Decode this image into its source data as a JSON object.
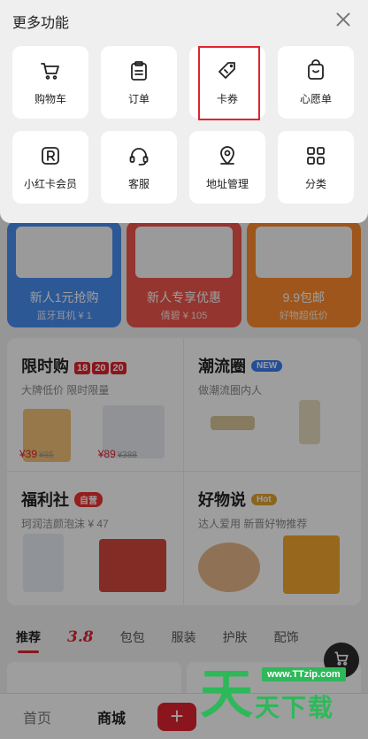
{
  "menu": {
    "title": "更多功能",
    "items": [
      {
        "label": "购物车",
        "icon": "shopping-cart-icon"
      },
      {
        "label": "订单",
        "icon": "clipboard-order-icon"
      },
      {
        "label": "卡券",
        "icon": "coupon-tag-icon"
      },
      {
        "label": "心愿单",
        "icon": "bag-smile-icon"
      },
      {
        "label": "小红卡会员",
        "icon": "r-badge-icon"
      },
      {
        "label": "客服",
        "icon": "headset-icon"
      },
      {
        "label": "地址管理",
        "icon": "location-pin-icon"
      },
      {
        "label": "分类",
        "icon": "category-grid-icon"
      }
    ],
    "highlighted_item": "卡券",
    "highlight_color": "#e0232f"
  },
  "promos": [
    {
      "title": "新人1元抢购",
      "sub": "蓝牙耳机 ¥ 1",
      "color": "#4a8ff2"
    },
    {
      "title": "新人专享优惠",
      "sub": "倩碧 ¥ 105",
      "color": "#f0564d"
    },
    {
      "title": "9.9包邮",
      "sub": "好物超低价",
      "color": "#ff8c2e"
    }
  ],
  "sections": {
    "flash": {
      "title": "限时购",
      "timer": [
        "18",
        "20",
        "20"
      ],
      "sub": "大牌低价 限时限量",
      "price1": "¥39",
      "orig1": "¥85",
      "price2": "¥89",
      "orig2": "¥388"
    },
    "trend": {
      "title": "潮流圈",
      "tag": "NEW",
      "sub": "做潮流圈内人"
    },
    "welfare": {
      "title": "福利社",
      "tag": "自营",
      "sub": "珂润洁颜泡沫 ¥ 47"
    },
    "goods": {
      "title": "好物说",
      "tag": "Hot",
      "sub": "达人爱用 新晋好物推荐"
    }
  },
  "tabs": [
    "推荐",
    "3.8",
    "包包",
    "服装",
    "护肤",
    "配饰"
  ],
  "bottom_nav": {
    "home": "首页",
    "mall": "商城",
    "plus": "+"
  },
  "watermark": {
    "url": "www.TTzip.com",
    "glyph": "天",
    "text": "天下载"
  }
}
